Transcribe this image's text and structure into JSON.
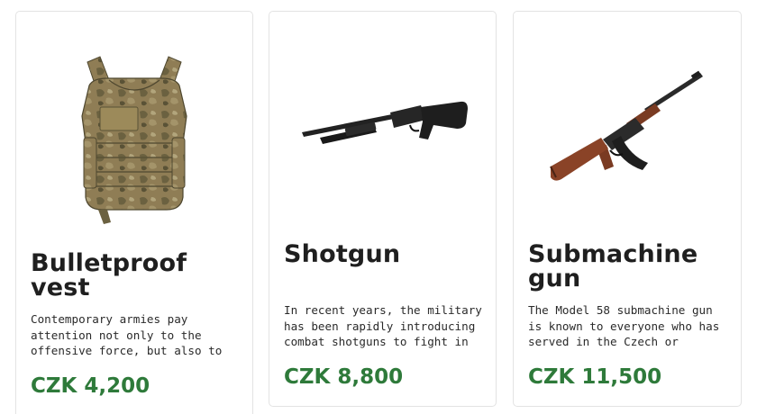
{
  "theme": {
    "price_color": "#2e7a3a",
    "title_color": "#1f1f1f",
    "card_border": "#e3e3e3"
  },
  "products": [
    {
      "image": "bulletproof-vest-image",
      "title": "Bulletproof vest",
      "description": "Contemporary armies pay attention not only to the offensive force, but also to",
      "price": "CZK 4,200"
    },
    {
      "image": "shotgun-image",
      "title": "Shotgun",
      "description": "In recent years, the military has been rapidly introducing combat shotguns to fight in",
      "price": "CZK 8,800"
    },
    {
      "image": "submachine-gun-image",
      "title": "Submachine gun",
      "description": "The Model 58 submachine gun is known to everyone who has served in the Czech or",
      "price": "CZK 11,500"
    }
  ]
}
